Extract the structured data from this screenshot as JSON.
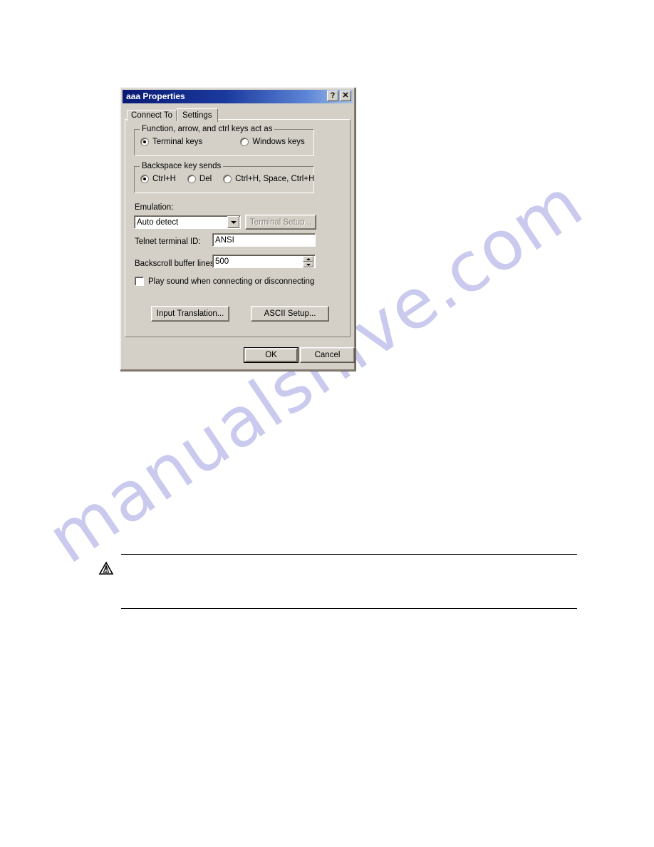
{
  "document": {
    "watermark_text": "manualshive.com",
    "note": {
      "icon": "warning-triangle-icon",
      "body_text": ""
    }
  },
  "dialog": {
    "title": "aaa Properties",
    "titlebar_buttons": [
      {
        "name": "help-button",
        "glyph": "?"
      },
      {
        "name": "close-button",
        "glyph": "✕"
      }
    ],
    "tabs": [
      {
        "label": "Connect To",
        "active": false
      },
      {
        "label": "Settings",
        "active": true
      }
    ],
    "groups": {
      "function_keys": {
        "legend": "Function, arrow, and ctrl keys act as",
        "options": [
          {
            "label": "Terminal keys",
            "checked": true
          },
          {
            "label": "Windows keys",
            "checked": false
          }
        ]
      },
      "backspace": {
        "legend": "Backspace key sends",
        "options": [
          {
            "label": "Ctrl+H",
            "checked": true
          },
          {
            "label": "Del",
            "checked": false
          },
          {
            "label": "Ctrl+H, Space, Ctrl+H",
            "checked": false
          }
        ]
      }
    },
    "emulation": {
      "label": "Emulation:",
      "selected": "Auto detect",
      "setup_button": "Terminal Setup...",
      "setup_button_disabled": true
    },
    "telnet_terminal_id": {
      "label": "Telnet terminal ID:",
      "value": "ANSI"
    },
    "backscroll": {
      "label": "Backscroll buffer lines:",
      "value": "500"
    },
    "play_sound": {
      "label": "Play sound when connecting or disconnecting",
      "checked": false
    },
    "action_buttons": [
      {
        "label": "Input Translation...",
        "name": "input-translation-button"
      },
      {
        "label": "ASCII Setup...",
        "name": "ascii-setup-button"
      }
    ],
    "footer_buttons": [
      {
        "label": "OK",
        "name": "ok-button",
        "default": true
      },
      {
        "label": "Cancel",
        "name": "cancel-button",
        "default": false
      }
    ]
  },
  "colors": {
    "dialog_face": "#d4d0c8",
    "titlebar_start": "#0a1a74",
    "titlebar_end": "#a8c2ea",
    "watermark": "#c9caee",
    "page_background": "#ffffff"
  }
}
